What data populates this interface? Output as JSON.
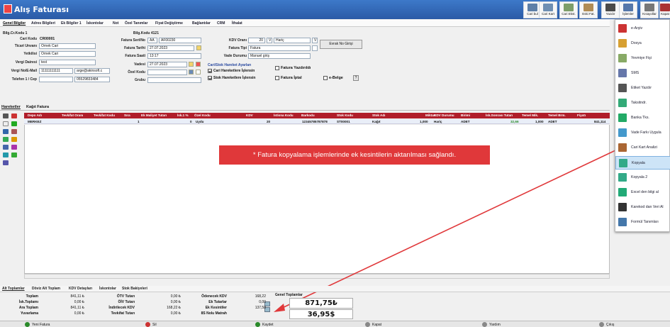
{
  "window": {
    "title": "Alış Faturası"
  },
  "toolbar": [
    {
      "label": "Cari bul",
      "color": "#5d7fa8"
    },
    {
      "label": "Cari Kart",
      "color": "#6f8fb3"
    },
    {
      "label": "Cari Ekst.",
      "color": "#7d9e6a"
    },
    {
      "label": "Eski Fat.",
      "color": "#b08c55"
    },
    {
      "label": "Yazdır",
      "color": "#4a4a4a"
    },
    {
      "label": "İşlemler",
      "color": "#5577aa"
    },
    {
      "label": "Kısayollar",
      "color": "#777777"
    },
    {
      "label": "Kapat",
      "color": "#a33"
    }
  ],
  "tabs": [
    "Genel Bilgiler",
    "Adres Bilgileri",
    "Ek Bilgiler 1",
    "İskontolar",
    "Not",
    "Özel Tanımlar",
    "Fiyat Değiştirme",
    "Bağlantılar",
    "CRM",
    "İthalat"
  ],
  "form": {
    "bilgi_cr_kodu": {
      "label": "Bilg.Cr.Kodu",
      "value": "1"
    },
    "cari_kodu": {
      "label": "Cari Kodu",
      "value": "CR00001"
    },
    "ticari_unvani": {
      "label": "Ticari Unvanı",
      "value": "Örnek Cari"
    },
    "yetkilisi": {
      "label": "Yetkilisi",
      "value": "Örnek Cari"
    },
    "vergi_dairesi": {
      "label": "Vergi Dairesi",
      "value": "test"
    },
    "vergi_no": {
      "label": "Vergi No/E-Mail",
      "value": "11111111111",
      "email": "arge@akinsoft.c"
    },
    "telefon": {
      "label": "Telefon 1 / Cep",
      "value": "",
      "cep": "05529833484"
    },
    "bilg_kodu": {
      "label": "Bilg.Kodu",
      "value": "4121"
    },
    "fatura_seri": {
      "label": "Fatura Seri/No",
      "seri": "AA",
      "no": "AF00230"
    },
    "fatura_tarihi": {
      "label": "Fatura Tarihi",
      "value": "27.07.2023"
    },
    "fatura_saati": {
      "label": "Fatura Saati",
      "value": "13:17"
    },
    "vadesi": {
      "label": "Vadesi",
      "value": "27.07.2023"
    },
    "ozel_kodu": {
      "label": "Özel Kodu",
      "value": ""
    },
    "grubu": {
      "label": "Grubu",
      "value": ""
    },
    "kdv_orani": {
      "label": "KDV Oranı",
      "value": "20",
      "mode": "Hariç",
      "v1": "V",
      "v2": "V"
    },
    "fatura_tipi": {
      "label": "Fatura Tipi",
      "value": "Fatura"
    },
    "vade_durumu": {
      "label": "Vade Durumu",
      "value": "Manuel giriş"
    },
    "evrak_btn": "Evrak No Girişi",
    "ayarlar_title": "Cari/Stok Hareket Ayarları",
    "cari_hareket": "Cari Hareketlere İşlensin",
    "stok_hareket": "Stok Hareketlere İşlensin",
    "yazdirildi": "Fatura Yazdırıldı",
    "iptal": "Fatura İptal",
    "ebelge": "e-Belge",
    "q": "?"
  },
  "subtabs": [
    "Hareketler",
    "Kağıt Fatura"
  ],
  "grid": {
    "headers": [
      "Depo Adı",
      "Tevkifat Oranı",
      "Tevkifat Kodu",
      "Sıra",
      "Ek Maliyet Tutarı",
      "İsk.1 %",
      "Özel Kodu",
      "KDV",
      "İstisna Kodu",
      "Barkodu",
      "Stok Kodu",
      "Stok Adı",
      "Miktarı",
      "KDV Durumu",
      "Birimi",
      "İsk.Sonrası Tutarı",
      "Temel Mik.",
      "Temel Brm.",
      "Fiyatı"
    ],
    "row": {
      "depo": "MERKEZ",
      "sira": "1",
      "ek_maliyet": "0",
      "ozel": "Uydu",
      "kdv": "20",
      "barkod": "12345785787878",
      "stok_kodu": "ST00001",
      "stok_adi": "Kağıt",
      "miktar": "1,000",
      "kdv_durumu": "Hariç",
      "birimi": "ADET",
      "isk_sonrasi": "32,66",
      "temel_mik": "1,000",
      "temel_brm": "ADET",
      "fiyat": "841,114"
    }
  },
  "notice": "* Fatura kopyalama işlemlerinde ek kesintilerin aktarılması sağlandı.",
  "menu": [
    {
      "label": "e-Arşiv",
      "color": "#c33"
    },
    {
      "label": "Dosya",
      "color": "#d7a032"
    },
    {
      "label": "Yevmiye Fişi",
      "color": "#8a6"
    },
    {
      "label": "SMS",
      "color": "#67a"
    },
    {
      "label": "Etiket Yazdır",
      "color": "#555"
    },
    {
      "label": "Taksitndr.",
      "color": "#3a7"
    },
    {
      "label": "Banka Tks.",
      "color": "#2a6"
    },
    {
      "label": "Vade Farkı Uygula",
      "color": "#49c"
    },
    {
      "label": "Cari Kart Analizi",
      "color": "#a63"
    },
    {
      "label": "Kopyala",
      "color": "#3a8"
    },
    {
      "label": "Kopyala 2",
      "color": "#3a8"
    },
    {
      "label": "Excel den bilgi al",
      "color": "#2a7"
    },
    {
      "label": "Karekod dan Veri Al",
      "color": "#333"
    },
    {
      "label": "Formül Tanımları",
      "color": "#47a"
    }
  ],
  "bottom_tabs": [
    "Alt Toplamlar",
    "Döviz Alt Toplam",
    "KDV Detayları",
    "İskontolar",
    "Stok Bakiyeleri"
  ],
  "totals": {
    "col1": [
      [
        "Toplam",
        "841,11 ₺"
      ],
      [
        "İsk.Toplamı",
        "0,00 ₺"
      ],
      [
        "Ara Toplam",
        "841,11 ₺"
      ],
      [
        "Yuvarlama",
        "0,00 ₺"
      ]
    ],
    "col2": [
      [
        "ÖTV Tutarı",
        "0,00 ₺"
      ],
      [
        "ÖİV Tutarı",
        "0,00 ₺"
      ],
      [
        "İndirilecek KDV",
        "168,22 ₺"
      ],
      [
        "Tevkifat Tutarı",
        "0,00 ₺"
      ]
    ],
    "col3": [
      [
        "Ödenecek KDV",
        "168,22"
      ],
      [
        "Ek Tutarlar",
        "0,00"
      ],
      [
        "Ek Kesintiler",
        "137,58"
      ],
      [
        "8S Nolu Matrah",
        ""
      ]
    ],
    "genel_label": "Genel Toplamlar",
    "genel_tl": "871,75₺",
    "genel_usd": "36,95$"
  },
  "footer": [
    "Yeni Fatura",
    "Sil",
    "Kaydet",
    "Kapat",
    "Yardım",
    "Çıkış"
  ]
}
